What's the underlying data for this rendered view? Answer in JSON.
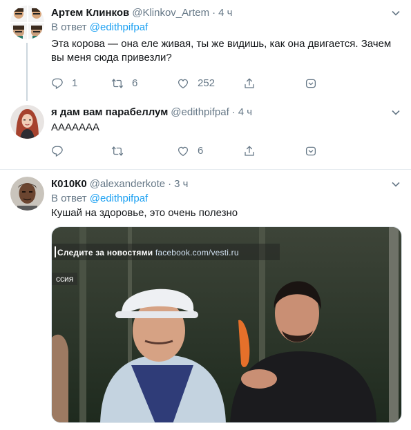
{
  "tweets": [
    {
      "name": "Артем Клинков",
      "handle": "@Klinkov_Artem",
      "dot": "·",
      "time": "4 ч",
      "reply_prefix": "В ответ",
      "reply_mention": "@edithpifpaf",
      "text": "Эта корова — она еле живая, ты же видишь, как она двигается. Зачем вы меня сюда привезли?",
      "replies": "1",
      "retweets": "6",
      "likes": "252"
    },
    {
      "name": "я дам вам парабеллум",
      "handle": "@edithpifpaf",
      "dot": "·",
      "time": "4 ч",
      "text": "ААААААА",
      "replies": "",
      "retweets": "",
      "likes": "6"
    },
    {
      "name": "К010К0",
      "handle": "@alexanderkote",
      "dot": "·",
      "time": "3 ч",
      "reply_prefix": "В ответ",
      "reply_mention": "@edithpifpaf",
      "text": "Кушай на здоровье, это очень полезно",
      "media": {
        "caption": "Следите за новостями",
        "url": "facebook.com/vesti.ru",
        "region": "ссия"
      }
    }
  ],
  "colors": {
    "accent": "#1da1f2",
    "secondary_text": "#657786",
    "divider": "#e6ecf0"
  },
  "icons": [
    "reply-icon",
    "retweet-icon",
    "like-icon",
    "share-icon",
    "more-icon",
    "chevron-down-icon"
  ]
}
